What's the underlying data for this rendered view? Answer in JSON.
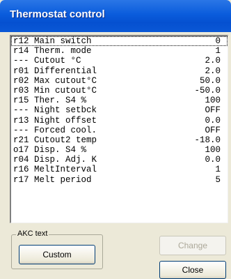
{
  "window": {
    "title": "Thermostat control"
  },
  "params": [
    {
      "name": "r12 Main switch",
      "value": "0"
    },
    {
      "name": "r14 Therm. mode",
      "value": "1"
    },
    {
      "name": "--- Cutout °C",
      "value": "2.0"
    },
    {
      "name": "r01 Differential",
      "value": "2.0"
    },
    {
      "name": "r02 Max cutout°C",
      "value": "50.0"
    },
    {
      "name": "r03 Min cutout°C",
      "value": "-50.0"
    },
    {
      "name": "r15 Ther. S4 %",
      "value": "100"
    },
    {
      "name": "--- Night setbck",
      "value": "OFF"
    },
    {
      "name": "r13 Night offset",
      "value": "0.0"
    },
    {
      "name": "--- Forced cool.",
      "value": "OFF"
    },
    {
      "name": "r21 Cutout2 temp",
      "value": "-18.0"
    },
    {
      "name": "o17 Disp. S4 %",
      "value": "100"
    },
    {
      "name": "r04 Disp. Adj. K",
      "value": "0.0"
    },
    {
      "name": "r16 MeltInterval",
      "value": "1"
    },
    {
      "name": "r17 Melt period",
      "value": "5"
    }
  ],
  "akc_group": {
    "label": "AKC text",
    "custom_label": "Custom"
  },
  "buttons": {
    "change_label": "Change",
    "close_label": "Close"
  },
  "colors": {
    "titlebar": "#0a5cdc",
    "window_bg": "#ece9d8"
  }
}
